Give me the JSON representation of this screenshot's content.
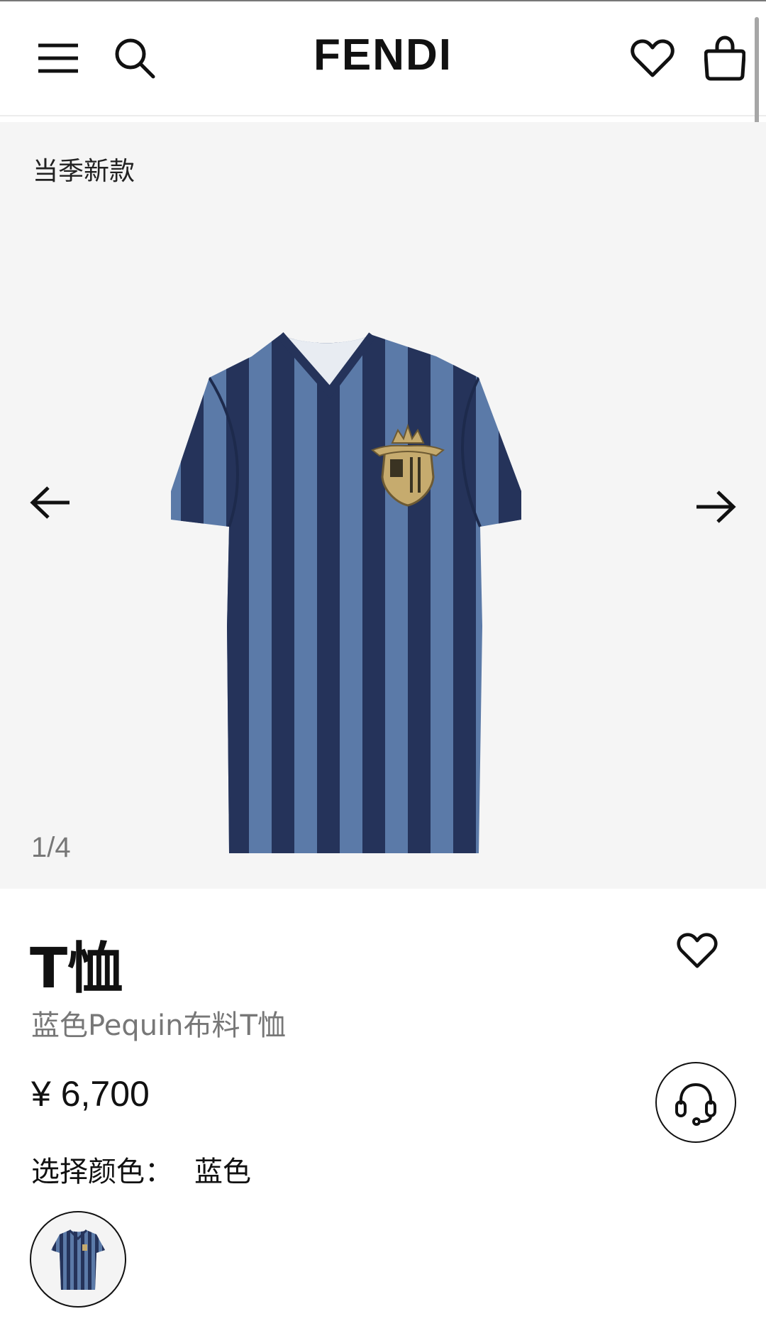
{
  "header": {
    "brand": "FENDI",
    "icons": [
      "menu-icon",
      "search-icon",
      "heart-icon",
      "bag-icon"
    ]
  },
  "gallery": {
    "badge": "当季新款",
    "counter": "1/4",
    "image_alt": "blue striped t-shirt with gold crest emblem"
  },
  "product": {
    "title": "T恤",
    "subtitle": "蓝色Pequin布料T恤",
    "price": "¥ 6,700",
    "color_label": "选择颜色：",
    "color_value": "蓝色"
  },
  "colors": {
    "stripe_light": "#5b7aa8",
    "stripe_dark": "#25335a",
    "crest": "#b59b63",
    "gallery_bg": "#f5f5f5"
  }
}
